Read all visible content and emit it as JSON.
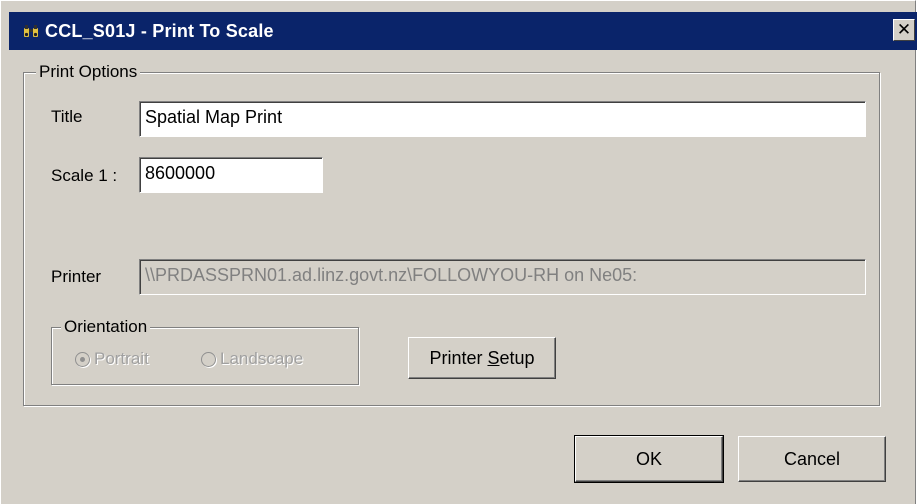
{
  "window": {
    "title": "CCL_S01J - Print To Scale",
    "app_icon": "binoculars-icon",
    "close_glyph": "✕"
  },
  "print_options": {
    "legend": "Print Options",
    "title_label": "Title",
    "title_value": "Spatial Map Print",
    "scale_label": "Scale 1 :",
    "scale_value": "8600000",
    "printer_label": "Printer",
    "printer_value": "\\\\PRDASSPRN01.ad.linz.govt.nz\\FOLLOWYOU-RH on Ne05:"
  },
  "orientation": {
    "legend": "Orientation",
    "options": [
      {
        "label": "Portrait",
        "checked": true
      },
      {
        "label": "Landscape",
        "checked": false
      }
    ]
  },
  "buttons": {
    "printer_setup_prefix": "Printer ",
    "printer_setup_mnemonic": "S",
    "printer_setup_suffix": "etup",
    "ok": "OK",
    "cancel": "Cancel"
  }
}
